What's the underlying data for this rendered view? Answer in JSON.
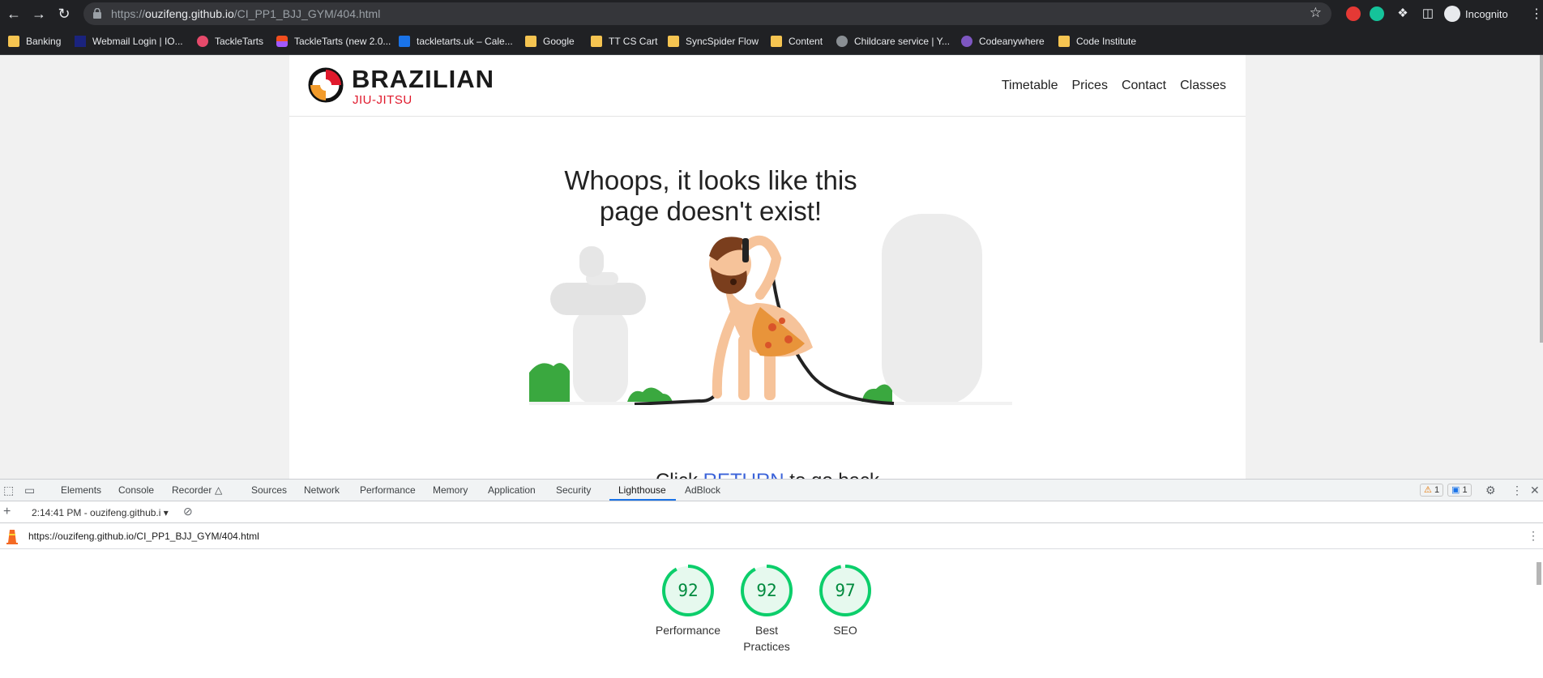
{
  "browser": {
    "url_prefix": "https://",
    "url_host": "ouzifeng.github.io",
    "url_path": "/CI_PP1_BJJ_GYM/404.html",
    "profile_label": "Incognito"
  },
  "bookmarks": [
    {
      "label": "Banking",
      "icon": "folder-icon"
    },
    {
      "label": "Webmail Login | IO...",
      "icon": "webmail-icon"
    },
    {
      "label": "TackleTarts",
      "icon": "tackletarts-icon"
    },
    {
      "label": "TackleTarts (new 2.0...",
      "icon": "figma-icon"
    },
    {
      "label": "tackletarts.uk – Cale...",
      "icon": "calendar-icon"
    },
    {
      "label": "Google",
      "icon": "folder-icon"
    },
    {
      "label": "TT CS Cart",
      "icon": "folder-icon"
    },
    {
      "label": "SyncSpider Flow",
      "icon": "folder-icon"
    },
    {
      "label": "Content",
      "icon": "folder-icon"
    },
    {
      "label": "Childcare service | Y...",
      "icon": "globe-icon"
    },
    {
      "label": "Codeanywhere",
      "icon": "codeanywhere-icon"
    },
    {
      "label": "Code Institute",
      "icon": "folder-icon"
    }
  ],
  "site": {
    "brand_top": "BRAZILIAN",
    "brand_bottom": "JIU-JITSU",
    "nav": [
      "Timetable",
      "Prices",
      "Contact",
      "Classes"
    ],
    "headline": "Whoops, it looks like this page doesn't exist!",
    "return_prefix": "Click",
    "return_link": "RETURN",
    "return_suffix": "to go back"
  },
  "devtools": {
    "tabs": [
      "Elements",
      "Console",
      "Recorder",
      "Sources",
      "Network",
      "Performance",
      "Memory",
      "Application",
      "Security",
      "Lighthouse",
      "AdBlock"
    ],
    "active_tab": "Lighthouse",
    "warnings_count": "1",
    "messages_count": "1",
    "report_selector": "2:14:41 PM - ouzifeng.github.i",
    "report_url": "https://ouzifeng.github.io/CI_PP1_BJJ_GYM/404.html",
    "scores": [
      {
        "label": "Performance",
        "value": 92
      },
      {
        "label": "Best Practices",
        "value": 92
      },
      {
        "label": "SEO",
        "value": 97
      }
    ],
    "score_color": "#0cce6b"
  }
}
